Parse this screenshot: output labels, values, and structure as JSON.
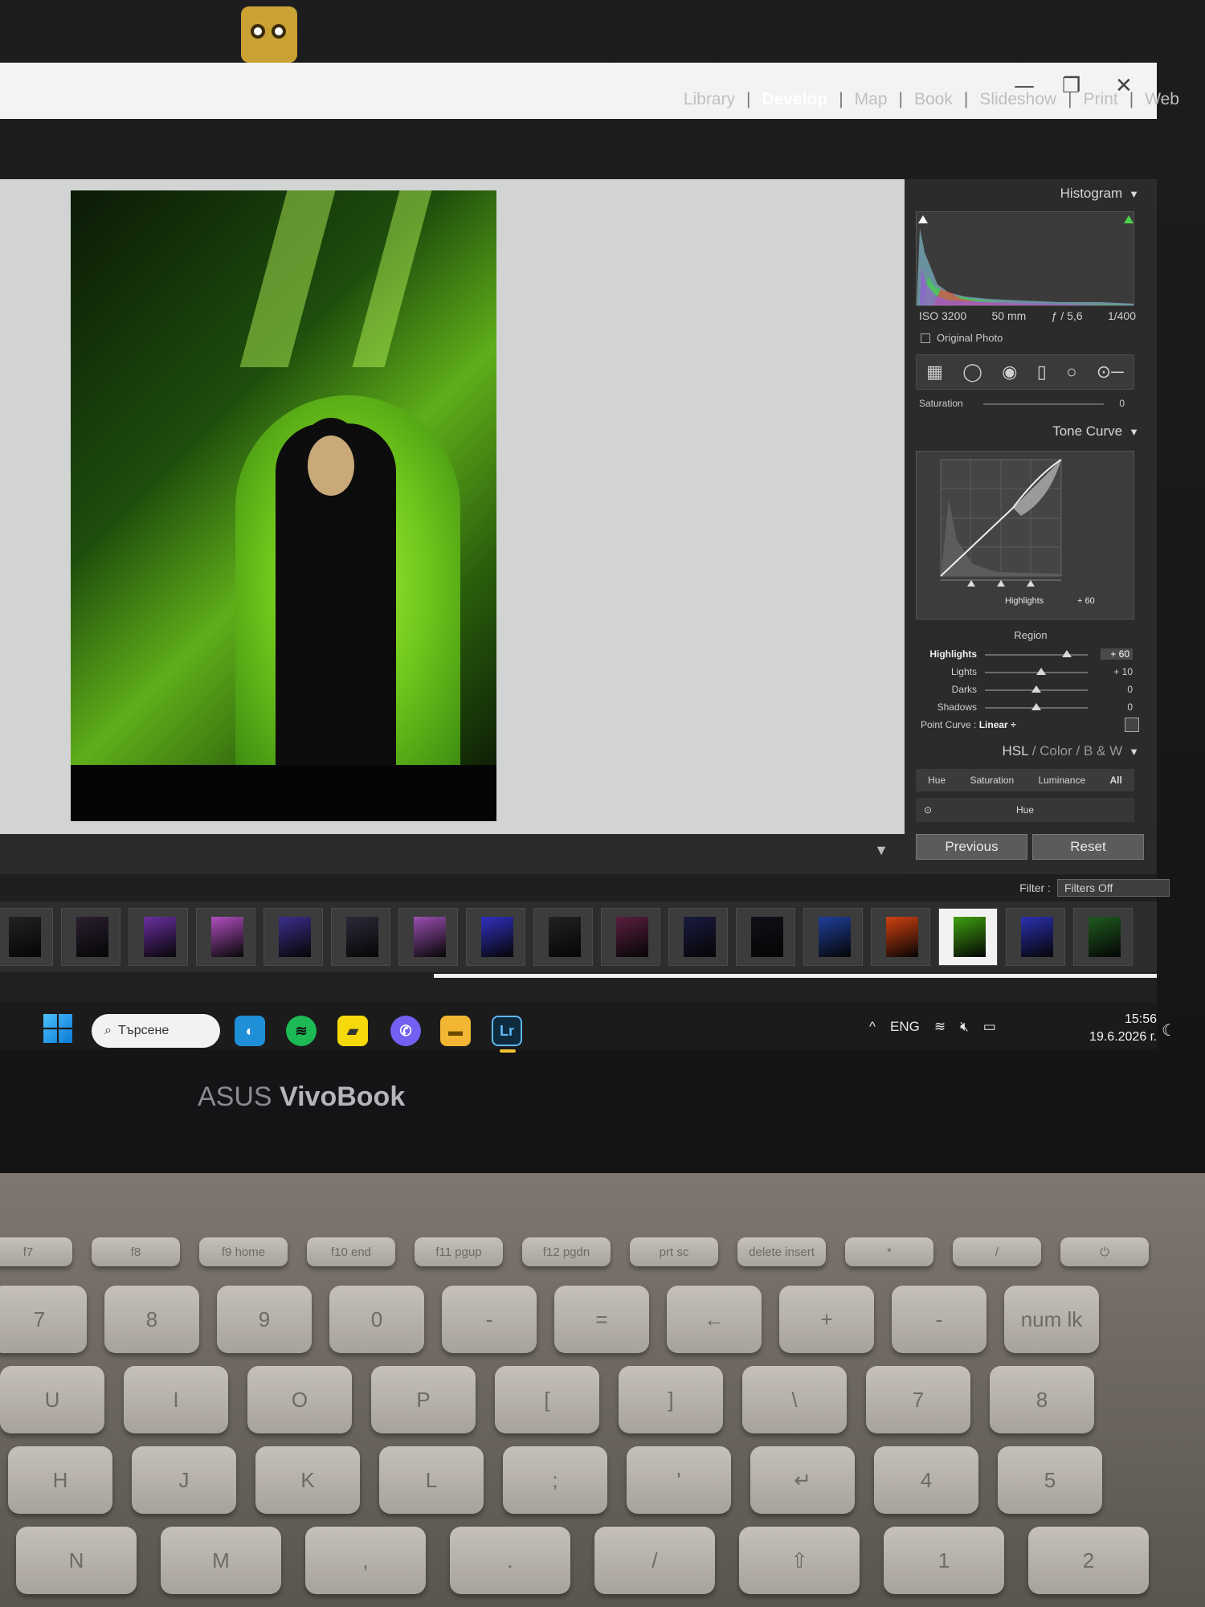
{
  "laptop": {
    "brand_a": "ASUS ",
    "brand_b": "VivoBook"
  },
  "window": {
    "minimize": "—",
    "restore": "❐",
    "close": "✕"
  },
  "modules": [
    "Library",
    "Develop",
    "Map",
    "Book",
    "Slideshow",
    "Print",
    "Web"
  ],
  "active_module": "Develop",
  "histogram": {
    "title": "Histogram",
    "iso": "ISO 3200",
    "focal": "50 mm",
    "aperture": "ƒ / 5,6",
    "shutter": "1/400",
    "original_photo": "Original Photo"
  },
  "saturation_row": {
    "label": "Saturation",
    "value": "0"
  },
  "tone_curve": {
    "title": "Tone Curve",
    "curve_label": "Highlights",
    "curve_value": "+ 60",
    "region_title": "Region",
    "sliders": [
      {
        "label": "Highlights",
        "value": "+ 60",
        "level": 0.8
      },
      {
        "label": "Lights",
        "value": "+ 10",
        "level": 0.55
      },
      {
        "label": "Darks",
        "value": "0",
        "level": 0.5
      },
      {
        "label": "Shadows",
        "value": "0",
        "level": 0.5
      }
    ],
    "point_curve_label": "Point Curve :",
    "point_curve_value": "Linear ÷"
  },
  "hsl": {
    "title_a": "HSL",
    "sep": " / ",
    "title_b": "Color",
    "title_c": "B & W",
    "tabs": [
      "Hue",
      "Saturation",
      "Luminance",
      "All"
    ],
    "hue_label": "Hue"
  },
  "buttons": {
    "previous": "Previous",
    "reset": "Reset"
  },
  "filter": {
    "label": "Filter :",
    "value": "Filters Off"
  },
  "taskbar": {
    "search": "Търсене",
    "lr": "Lr",
    "lang": "ENG",
    "time": "15:56",
    "date": "19.6.2026 г."
  },
  "keyboard": {
    "fn_row": [
      "f7",
      "f8",
      "f9 home",
      "f10 end",
      "f11 pgup",
      "f12 pgdn",
      "prt sc",
      "delete insert",
      "*",
      "/",
      "⏻"
    ],
    "num_row": [
      "7",
      "8",
      "9",
      "0",
      "-",
      "=",
      "←",
      "+",
      "-",
      "num lk"
    ],
    "row2": [
      "U",
      "I",
      "O",
      "P",
      "[",
      "]",
      "\\",
      "7",
      "8"
    ],
    "row3": [
      "H",
      "J",
      "K",
      "L",
      ";",
      "'",
      "↵",
      "4",
      "5"
    ],
    "row4": [
      "N",
      "M",
      ",",
      ".",
      "/",
      "⇧",
      "1",
      "2"
    ]
  },
  "colors": {
    "accent_active_thumb": "#f2f2f2",
    "panel_bg": "#2b2b2b",
    "photo_green": "#6fc61c"
  }
}
